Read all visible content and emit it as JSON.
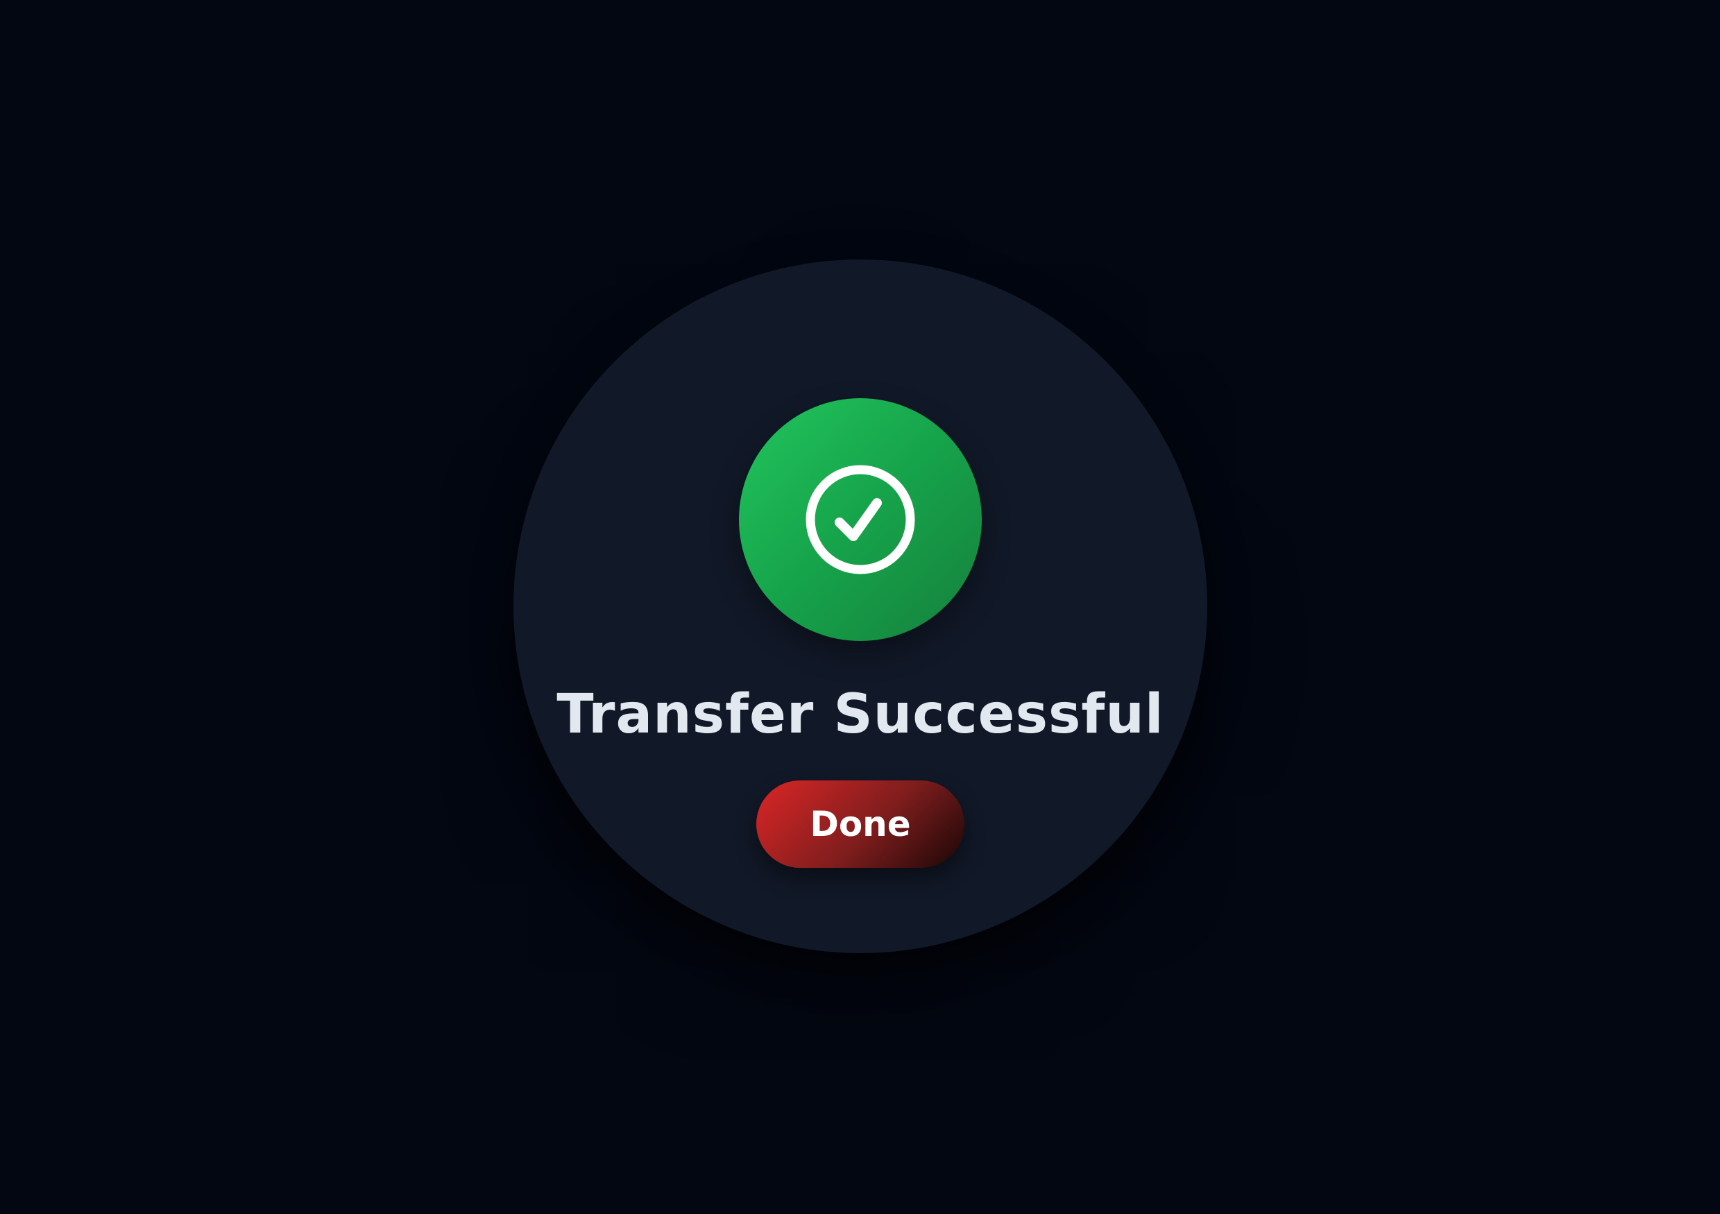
{
  "dialog": {
    "icon": "check-circle-icon",
    "title": "Transfer Successful",
    "done_label": "Done"
  },
  "colors": {
    "background": "#030712",
    "dialog": "#111827",
    "success": "#22c55e",
    "button": "#dc2626",
    "title_text": "#e2e8f0"
  }
}
